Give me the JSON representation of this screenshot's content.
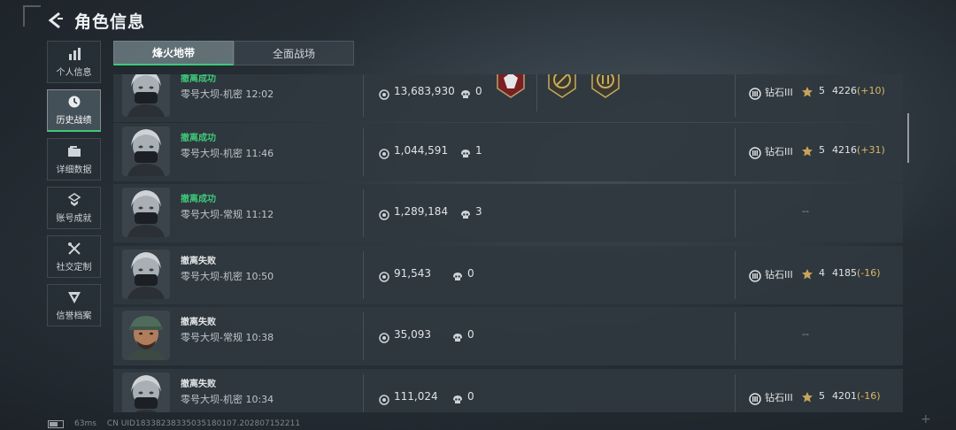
{
  "header": {
    "title": "角色信息"
  },
  "sidebar": {
    "items": [
      {
        "label": "个人信息",
        "icon": "bar-chart-icon"
      },
      {
        "label": "历史战绩",
        "icon": "clock-icon",
        "active": true
      },
      {
        "label": "详细数据",
        "icon": "folder-icon"
      },
      {
        "label": "账号成就",
        "icon": "medal-icon"
      },
      {
        "label": "社交定制",
        "icon": "tools-icon"
      },
      {
        "label": "信誉档案",
        "icon": "shield-icon"
      }
    ]
  },
  "tabs": [
    {
      "label": "烽火地带",
      "active": true
    },
    {
      "label": "全面战场",
      "active": false
    }
  ],
  "matches": [
    {
      "status": "撤离成功",
      "result": "success",
      "map": "零号大坝-机密 12:02",
      "money": "13,683,930",
      "kills": "0",
      "rank": "钻石III",
      "stars": "5",
      "score": "4226",
      "delta": "(+10)",
      "has_badges": true
    },
    {
      "status": "撤离成功",
      "result": "success",
      "map": "零号大坝-机密 11:46",
      "money": "1,044,591",
      "kills": "1",
      "rank": "钻石III",
      "stars": "5",
      "score": "4216",
      "delta": "(+31)"
    },
    {
      "status": "撤离成功",
      "result": "success",
      "map": "零号大坝-常规 11:12",
      "money": "1,289,184",
      "kills": "3",
      "rank": "",
      "stars": "",
      "score": "",
      "delta": "",
      "empty": "--"
    },
    {
      "status": "撤离失败",
      "result": "fail",
      "map": "零号大坝-机密 10:50",
      "money": "91,543",
      "kills": "0",
      "rank": "钻石III",
      "stars": "4",
      "score": "4185",
      "delta": "(-16)"
    },
    {
      "status": "撤离失败",
      "result": "fail",
      "map": "零号大坝-常规 10:38",
      "money": "35,093",
      "kills": "0",
      "rank": "",
      "stars": "",
      "score": "",
      "delta": "",
      "empty": "--"
    },
    {
      "status": "撤离失败",
      "result": "fail",
      "map": "零号大坝-机密 10:34",
      "money": "111,024",
      "kills": "0",
      "rank": "钻石III",
      "stars": "5",
      "score": "4201",
      "delta": "(-16)"
    }
  ],
  "footer": {
    "ping": "63ms",
    "uid": "CN UID183382383350351801​07.202807152211"
  },
  "colors": {
    "success": "#3ec97a",
    "accent_gold": "#d9b766"
  }
}
